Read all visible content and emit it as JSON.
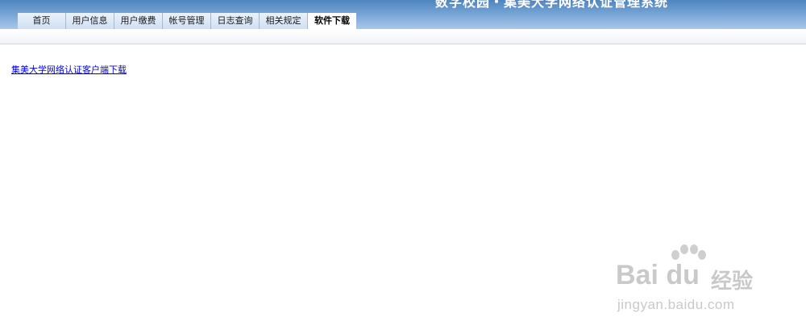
{
  "header": {
    "title": "数字校园・集美大学网络认证管理系统"
  },
  "nav": {
    "tabs": [
      {
        "label": "首页"
      },
      {
        "label": "用户信息"
      },
      {
        "label": "用户缴费"
      },
      {
        "label": "帐号管理"
      },
      {
        "label": "日志查询"
      },
      {
        "label": "相关规定"
      },
      {
        "label": "软件下载",
        "active": true
      }
    ]
  },
  "main": {
    "download_link": "集美大学网络认证客户端下载"
  },
  "watermark": {
    "logo_text": "Bai du",
    "logo_suffix": "经验",
    "url": "jingyan.baidu.com"
  }
}
